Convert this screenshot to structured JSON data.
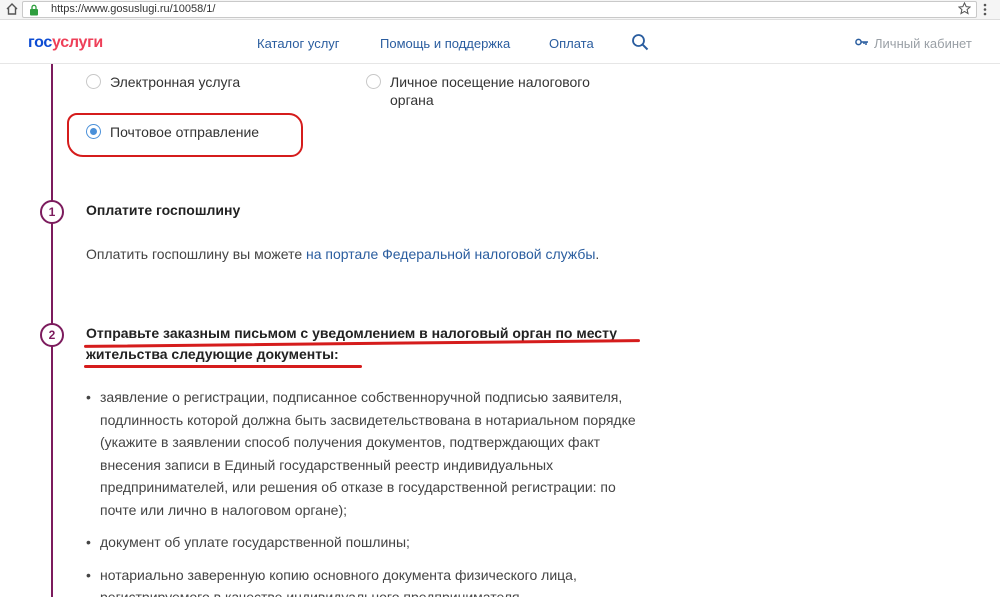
{
  "browser": {
    "url": "https://www.gosuslugi.ru/10058/1/"
  },
  "header": {
    "logo_part1": "гос",
    "logo_part2": "услуги",
    "nav": [
      "Каталог услуг",
      "Помощь и поддержка",
      "Оплата"
    ],
    "cabinet_label": "Личный кабинет",
    "colors": {
      "logo_blue": "#0d4cd3",
      "logo_red": "#ee3f58",
      "nav_link": "#2a5d9f"
    }
  },
  "options": {
    "electronic": "Электронная услуга",
    "personal_line1": "Личное посещение налогового",
    "personal_line2": "органа",
    "postal": "Почтовое отправление",
    "selected": "postal"
  },
  "steps": [
    {
      "number": "1",
      "title": "Оплатите госпошлину",
      "text_before": "Оплатить госпошлину вы можете ",
      "link_text": "на портале Федеральной налоговой службы",
      "text_after": "."
    },
    {
      "number": "2",
      "title_line1": "Отправьте заказным письмом с уведомлением в налоговый орган по месту",
      "title_line2": "жительства следующие документы:",
      "items": [
        "заявление о регистрации, подписанное собственноручной подписью заявителя, подлинность которой должна быть засвидетельствована в нотариальном порядке (укажите в заявлении способ получения документов, подтверждающих факт внесения записи в Единый государственный реестр индивидуальных предпринимателей, или решения об отказе в государственной регистрации: по почте или лично в налоговом органе);",
        "документ об уплате государственной пошлины;",
        "нотариально заверенную копию основного документа физического лица, регистрируемого в качестве индивидуального предпринимателя"
      ]
    }
  ],
  "accent_colors": {
    "timeline": "#7c1b5d",
    "annotation_red": "#d51c1c",
    "radio_blue": "#4a90d9"
  }
}
